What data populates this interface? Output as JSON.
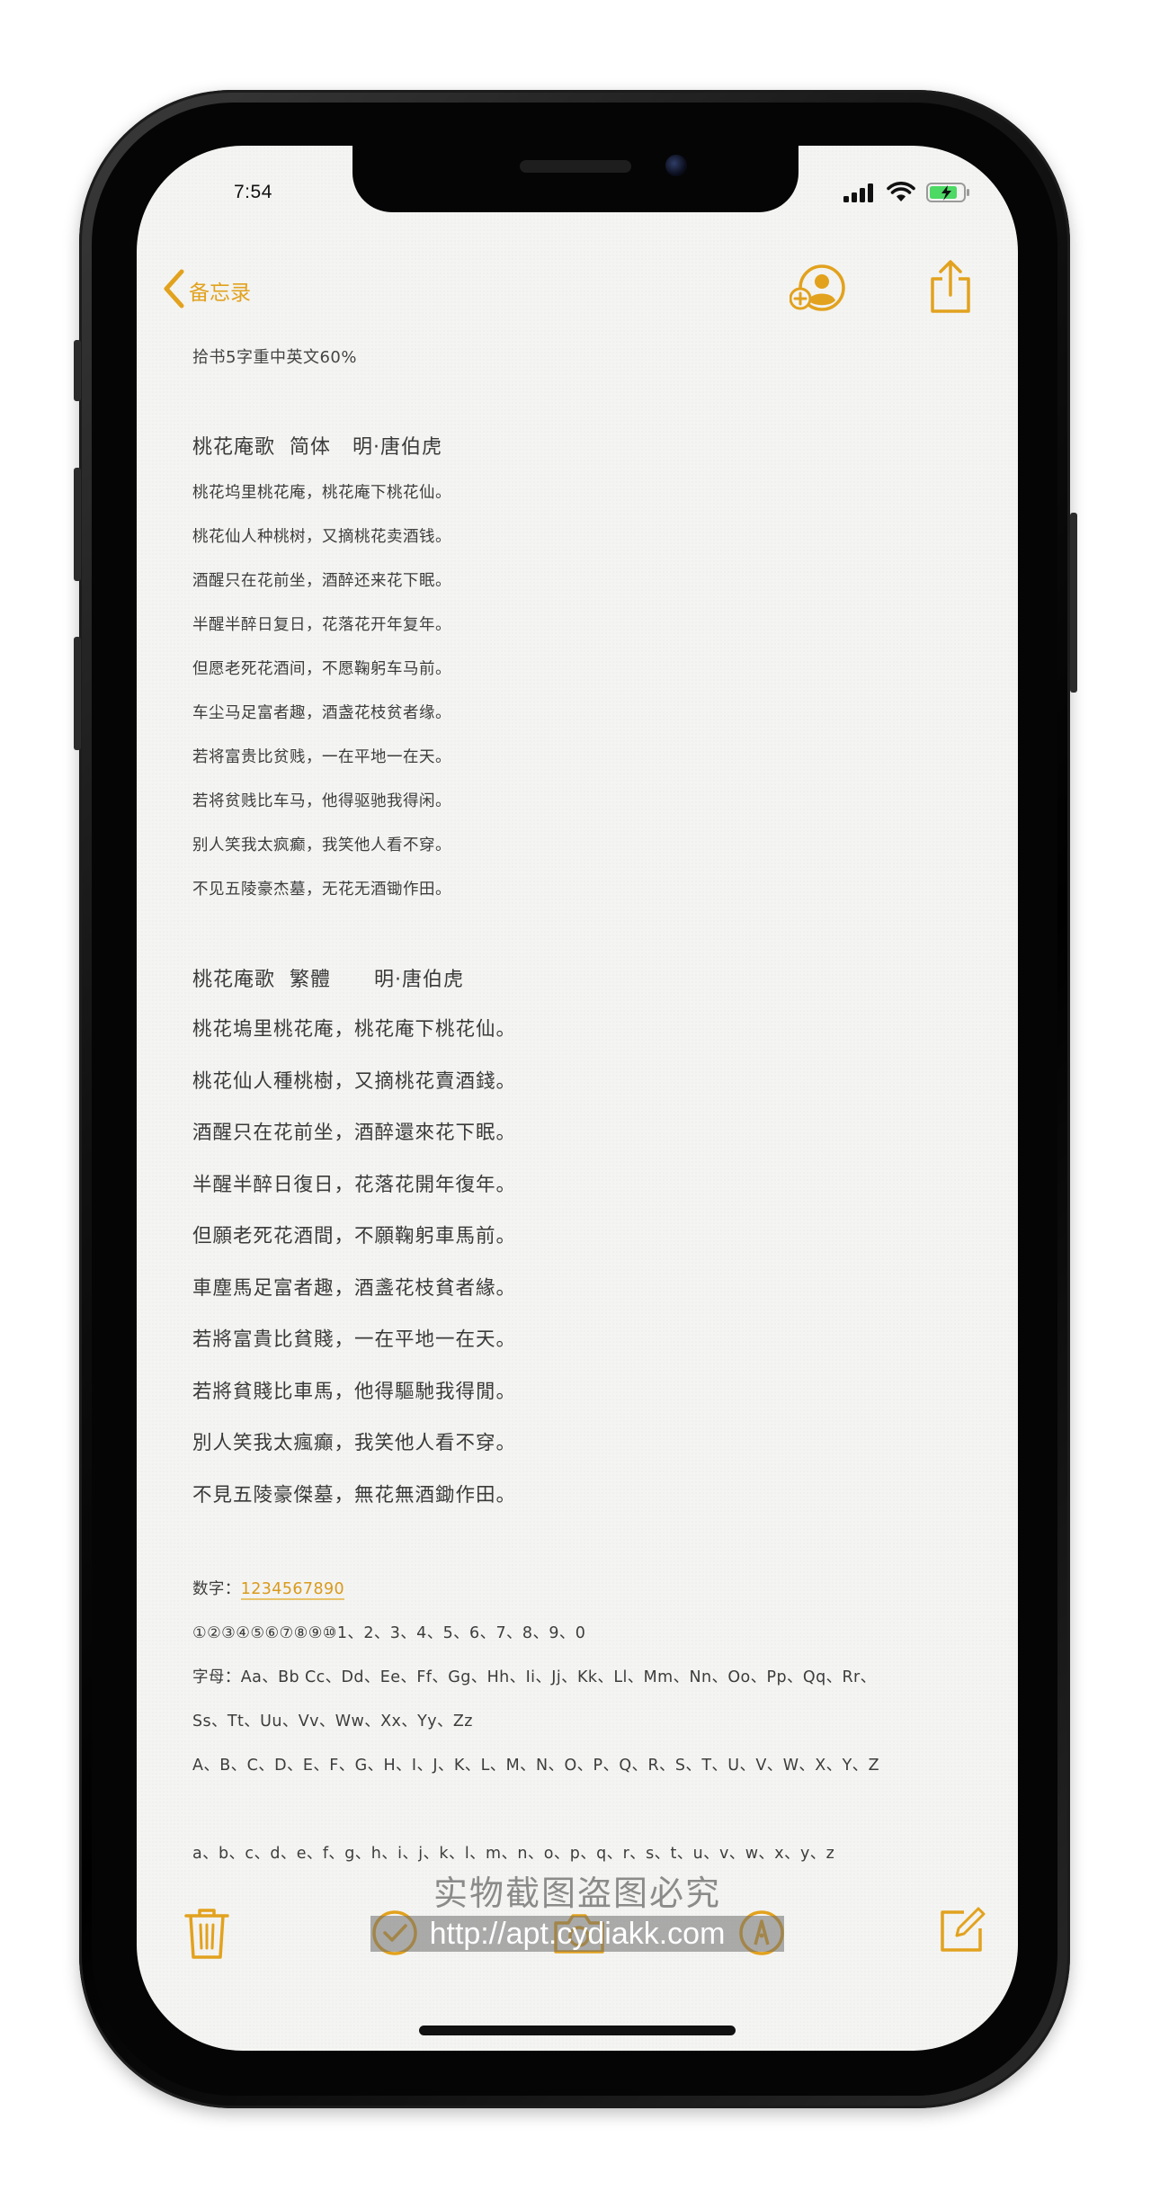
{
  "status": {
    "time": "7:54"
  },
  "nav": {
    "back_label": "备忘录"
  },
  "note": {
    "subtitle": "拾书5字重中英文60%",
    "simplified": {
      "heading": "桃花庵歌  简体   明·唐伯虎",
      "lines": [
        "桃花坞里桃花庵，桃花庵下桃花仙。",
        "桃花仙人种桃树，又摘桃花卖酒钱。",
        "酒醒只在花前坐，酒醉还来花下眠。",
        "半醒半醉日复日，花落花开年复年。",
        "但愿老死花酒间，不愿鞠躬车马前。",
        "车尘马足富者趣，酒盏花枝贫者缘。",
        "若将富贵比贫贱，一在平地一在天。",
        "若将贫贱比车马，他得驱驰我得闲。",
        "别人笑我太疯癫，我笑他人看不穿。",
        "不见五陵豪杰墓，无花无酒锄作田。"
      ]
    },
    "traditional": {
      "heading": "桃花庵歌  繁體      明·唐伯虎",
      "lines": [
        "桃花塢里桃花庵，桃花庵下桃花仙。",
        "桃花仙人種桃樹，又摘桃花賣酒錢。",
        "酒醒只在花前坐，酒醉還來花下眠。",
        "半醒半醉日復日，花落花開年復年。",
        "但願老死花酒間，不願鞠躬車馬前。",
        "車塵馬足富者趣，酒盞花枝貧者緣。",
        "若將富貴比貧賤，一在平地一在天。",
        "若將貧賤比車馬，他得驅馳我得閒。",
        "別人笑我太瘋癲，我笑他人看不穿。",
        "不見五陵豪傑墓，無花無酒鋤作田。"
      ]
    },
    "digits_label": "数字：",
    "digits_link": "1234567890",
    "circled": "①②③④⑤⑥⑦⑧⑨⑩1、2、3、4、5、6、7、8、9、0",
    "letters_1": "字母：Aa、Bb Cc、Dd、Ee、Ff、Gg、Hh、Ii、Jj、Kk、Ll、Mm、Nn、Oo、Pp、Qq、Rr、",
    "letters_2": "Ss、Tt、Uu、Vv、Ww、Xx、Yy、Zz",
    "upper": "A、B、C、D、E、F、G、H、I、J、K、L、M、N、O、P、Q、R、S、T、U、V、W、X、Y、Z",
    "lower": "a、b、c、d、e、f、g、h、i、j、k、l、m、n、o、p、q、r、s、t、u、v、w、x、y、z"
  },
  "watermark": {
    "text": "实物截图盗图必究",
    "url": "http://apt.cydiakk.com"
  },
  "colors": {
    "accent": "#e2a21e",
    "battery_green": "#4cd964"
  }
}
